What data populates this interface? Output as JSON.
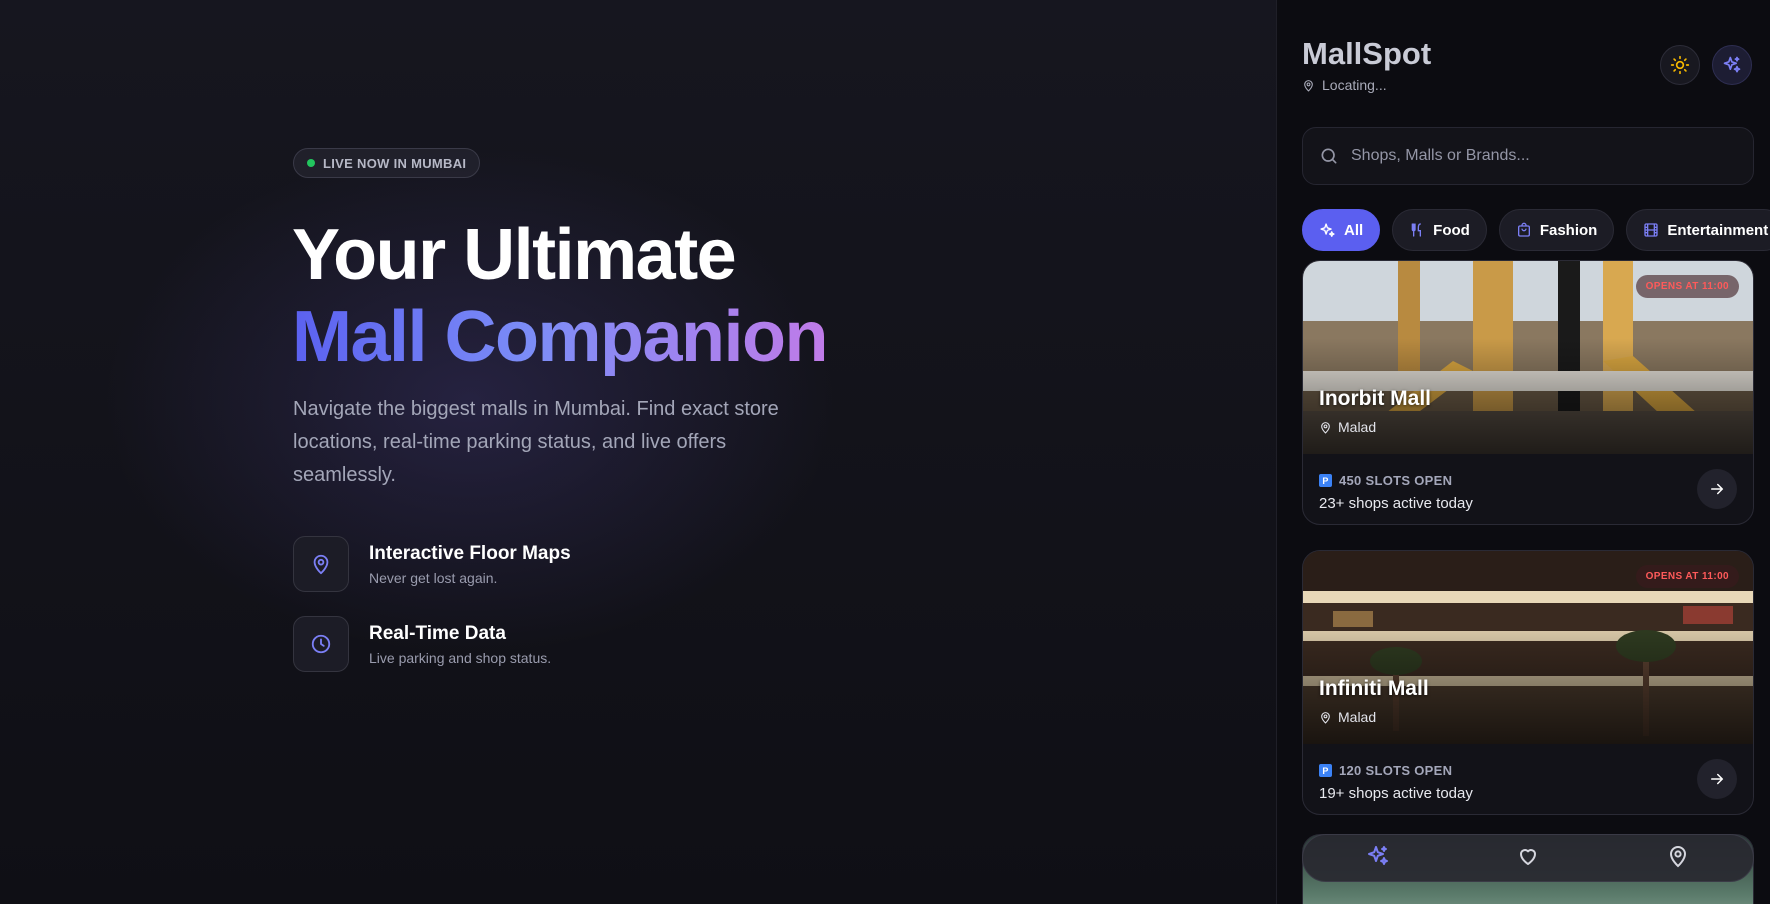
{
  "hero": {
    "badge": "LIVE NOW IN MUMBAI",
    "headline_line1": "Your Ultimate",
    "headline_line2": "Mall Companion",
    "subtext": "Navigate the biggest malls in Mumbai. Find exact store locations, real-time parking status, and live offers seamlessly.",
    "features": [
      {
        "icon": "map-pin-icon",
        "title": "Interactive Floor Maps",
        "desc": "Never get lost again."
      },
      {
        "icon": "clock-icon",
        "title": "Real-Time Data",
        "desc": "Live parking and shop status."
      }
    ]
  },
  "app": {
    "title": "MallSpot",
    "location": "Locating...",
    "search_placeholder": "Shops, Malls or Brands...",
    "categories": [
      {
        "label": "All",
        "icon": "sparkles-icon",
        "active": true
      },
      {
        "label": "Food",
        "icon": "utensils-icon",
        "active": false
      },
      {
        "label": "Fashion",
        "icon": "shopping-bag-icon",
        "active": false
      },
      {
        "label": "Entertainment",
        "icon": "film-icon",
        "active": false
      }
    ],
    "malls": [
      {
        "name": "Inorbit Mall",
        "location": "Malad",
        "status": "OPENS AT 11:00",
        "slots": "450 SLOTS OPEN",
        "shops": "23+ shops active today",
        "parking_badge": "P"
      },
      {
        "name": "Infiniti Mall",
        "location": "Malad",
        "status": "OPENS AT 11:00",
        "slots": "120 SLOTS OPEN",
        "shops": "19+ shops active today",
        "parking_badge": "P"
      }
    ],
    "bottom_nav": [
      "sparkles-icon",
      "heart-icon",
      "map-pin-icon"
    ]
  },
  "colors": {
    "accent": "#5b5ff0",
    "live_dot": "#22c55e",
    "status_red": "#ff5a5a",
    "sun_yellow": "#f5b800"
  }
}
